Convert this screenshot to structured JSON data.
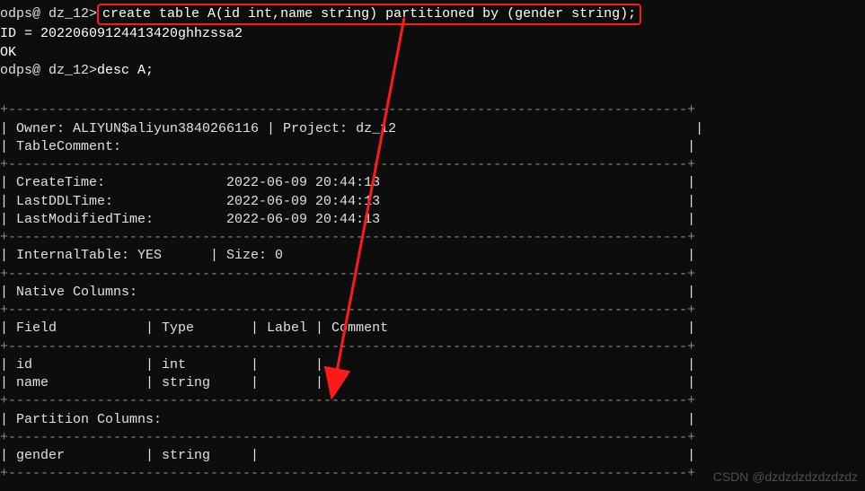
{
  "prompt1": {
    "prefix": "odps@ dz_12>",
    "command": "create table A(id int,name string) partitioned by (gender string);"
  },
  "output1": {
    "blank": "",
    "id_line": "ID = 20220609124413420ghhzssa2",
    "ok": "OK"
  },
  "prompt2": {
    "prefix": "odps@ dz_12>",
    "command": "desc A;"
  },
  "table": {
    "border_top": "+------------------------------------------------------------------------------------+",
    "owner_row": "| Owner: ALIYUN$aliyun3840266116 | Project: dz_12                                     |",
    "comment_row": "| TableComment:                                                                      |",
    "border_mid1": "+------------------------------------------------------------------------------------+",
    "createtime": "| CreateTime:               2022-06-09 20:44:13                                      |",
    "lastddl": "| LastDDLTime:              2022-06-09 20:44:13                                      |",
    "lastmod": "| LastModifiedTime:         2022-06-09 20:44:13                                      |",
    "border_mid2": "+------------------------------------------------------------------------------------+",
    "internal": "| InternalTable: YES      | Size: 0                                                  |",
    "border_mid3": "+------------------------------------------------------------------------------------+",
    "native_cols": "| Native Columns:                                                                    |",
    "border_mid4": "+------------------------------------------------------------------------------------+",
    "header": "| Field           | Type       | Label | Comment                                     |",
    "border_mid5": "+------------------------------------------------------------------------------------+",
    "col_id": "| id              | int        |       |                                             |",
    "col_name": "| name            | string     |       |                                             |",
    "border_mid6": "+------------------------------------------------------------------------------------+",
    "part_cols": "| Partition Columns:                                                                 |",
    "border_mid7": "+------------------------------------------------------------------------------------+",
    "col_gender": "| gender          | string     |                                                     |",
    "border_bot": "+------------------------------------------------------------------------------------+"
  },
  "watermark": "CSDN @dzdzdzdzdzdzdz",
  "annotation": {
    "arrow_color": "#ff1a1a"
  }
}
